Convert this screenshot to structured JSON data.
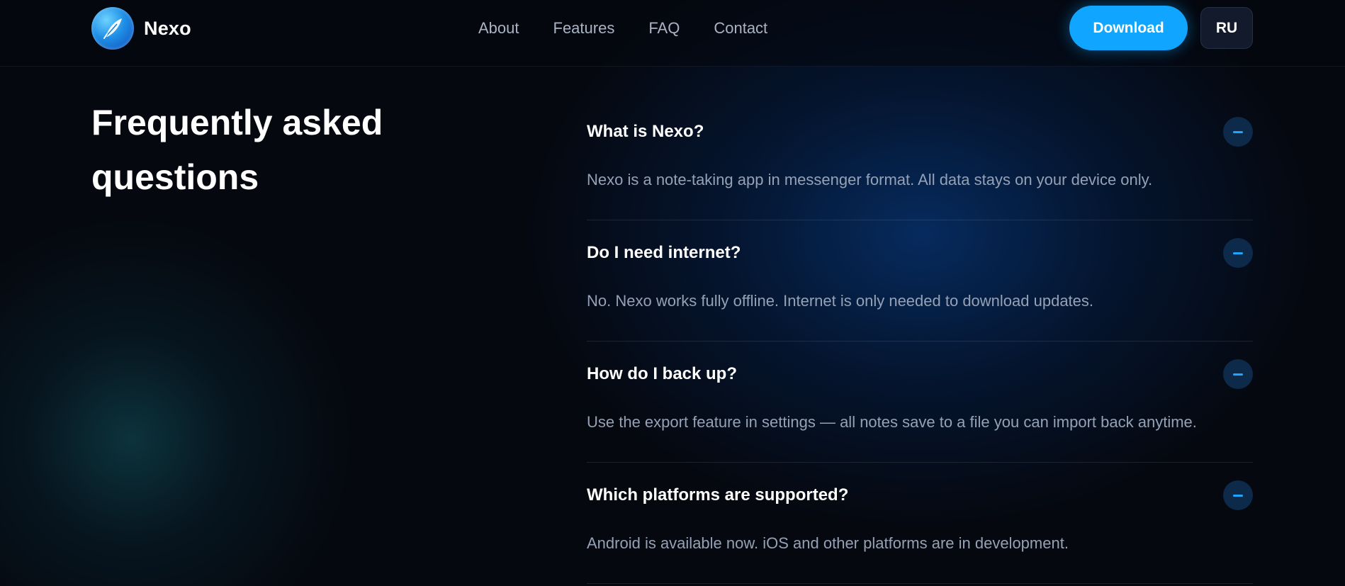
{
  "header": {
    "brand": "Nexo",
    "nav": [
      "About",
      "Features",
      "FAQ",
      "Contact"
    ],
    "download_label": "Download",
    "lang_label": "RU"
  },
  "main": {
    "title": "Frequently asked questions",
    "faq": [
      {
        "question": "What is Nexo?",
        "answer": "Nexo is a note-taking app in messenger format. All data stays on your device only.",
        "expanded": true
      },
      {
        "question": "Do I need internet?",
        "answer": "No. Nexo works fully offline. Internet is only needed to download updates.",
        "expanded": true
      },
      {
        "question": "How do I back up?",
        "answer": "Use the export feature in settings — all notes save to a file you can import back anytime.",
        "expanded": true
      },
      {
        "question": "Which platforms are supported?",
        "answer": "Android is available now. iOS and other platforms are in development.",
        "expanded": true
      }
    ]
  },
  "colors": {
    "background": "#05080f",
    "accent": "#10a6ff",
    "muted_text": "#95a1b5"
  },
  "icons": {
    "logo": "feather-logo-icon",
    "toggle": "minus-icon"
  }
}
